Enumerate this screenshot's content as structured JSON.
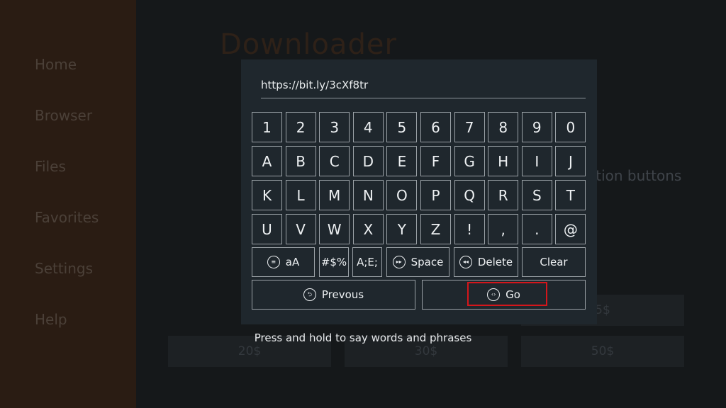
{
  "sidebar": {
    "items": [
      "Home",
      "Browser",
      "Files",
      "Favorites",
      "Settings",
      "Help"
    ]
  },
  "main": {
    "app_title": "Downloader",
    "hint_text": "ation buttons",
    "donations": [
      "5$",
      "20$",
      "30$",
      "50$"
    ]
  },
  "keyboard": {
    "url_value": "https://bit.ly/3cXf8tr",
    "rows": [
      [
        "1",
        "2",
        "3",
        "4",
        "5",
        "6",
        "7",
        "8",
        "9",
        "0"
      ],
      [
        "A",
        "B",
        "C",
        "D",
        "E",
        "F",
        "G",
        "H",
        "I",
        "J"
      ],
      [
        "K",
        "L",
        "M",
        "N",
        "O",
        "P",
        "Q",
        "R",
        "S",
        "T"
      ],
      [
        "U",
        "V",
        "W",
        "X",
        "Y",
        "Z",
        "!",
        ",",
        ".",
        "@"
      ]
    ],
    "case_key": "aA",
    "symbols_key": "#$%",
    "accents_key": "A;E;",
    "space_key": "Space",
    "delete_key": "Delete",
    "clear_key": "Clear",
    "previous_key": "Prevous",
    "go_key": "Go",
    "voice_hint": "Press and hold to say words and phrases"
  },
  "colors": {
    "highlight": "#d4161b",
    "sidebar": "#2a1c13",
    "modal": "#1f272d"
  }
}
